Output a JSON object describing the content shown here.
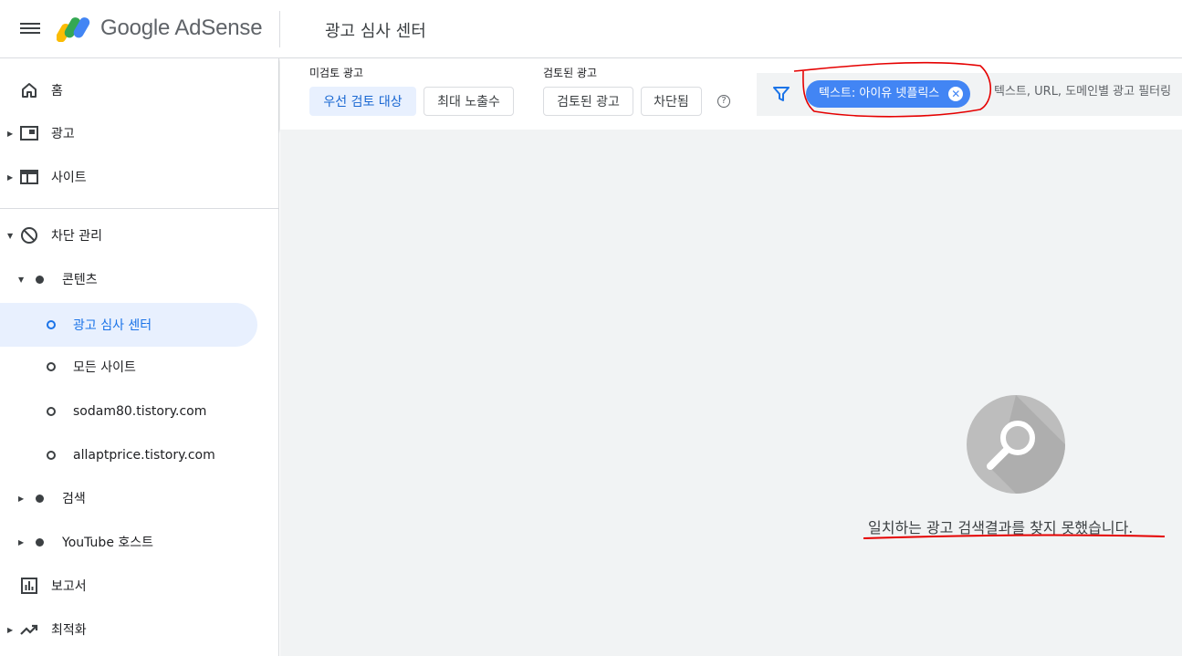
{
  "app": {
    "brand": "Google AdSense",
    "page_title": "광고 심사 센터"
  },
  "sidebar": {
    "home": "홈",
    "ads": "광고",
    "sites": "사이트",
    "blocking": "차단 관리",
    "content": "콘텐츠",
    "ad_review_center": "광고 심사 센터",
    "all_sites": "모든 사이트",
    "site1": "sodam80.tistory.com",
    "site2": "allaptprice.tistory.com",
    "search": "검색",
    "youtube_host": "YouTube 호스트",
    "reports": "보고서",
    "optimization": "최적화"
  },
  "filters": {
    "unreviewed_label": "미검토 광고",
    "priority_chip": "우선 검토 대상",
    "max_impressions_chip": "최대 노출수",
    "reviewed_label": "검토된 광고",
    "reviewed_chip": "검토된 광고",
    "blocked_chip": "차단됨",
    "help": "?",
    "active_filter": "텍스트: 아이유 넷플릭스",
    "search_placeholder": "텍스트, URL, 도메인별 광고 필터링"
  },
  "empty_state": {
    "message": "일치하는 광고 검색결과를 찾지 못했습니다."
  },
  "colors": {
    "accent": "#1a73e8",
    "chip": "#4285f4",
    "annotation": "#e50000"
  }
}
